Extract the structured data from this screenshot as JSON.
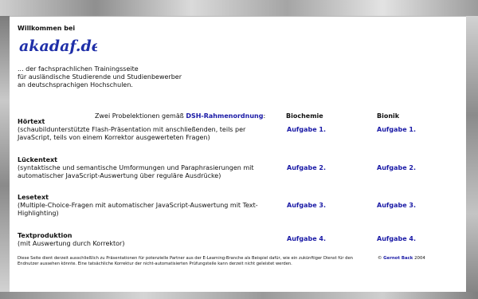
{
  "page": {
    "welcome": "Willkommen bei",
    "logo_text": "akadaf.de",
    "intro": [
      "... der fachsprachlichen Trainingsseite",
      "für ausländische Studierende und Studienbewerber",
      "an deutschsprachigen Hochschulen."
    ],
    "probe_prefix": "Zwei Probelektionen gemäß",
    "probe_link": "DSH-Rahmenordnung",
    "probe_suffix": ":",
    "columns": [
      "Biochemie",
      "Bionik"
    ],
    "sections": [
      {
        "title": "Hörtext",
        "desc": "(schaubildunterstützte Flash-Präsentation mit anschließenden, teils per JavaScript, teils von einem Korrektor ausgewerteten Fragen)",
        "task1": "Aufgabe 1.",
        "task2": "Aufgabe 1."
      },
      {
        "title": "Lückentext",
        "desc": "(syntaktische und semantische Umformungen und Paraphrasierungen mit automatischer JavaScript-Auswertung über reguläre Ausdrücke)",
        "task1": "Aufgabe 2.",
        "task2": "Aufgabe 2."
      },
      {
        "title": "Lesetext",
        "desc": "(Multiple-Choice-Fragen mit automatischer JavaScript-Auswertung mit Text-Highlighting)",
        "task1": "Aufgabe 3.",
        "task2": "Aufgabe 3."
      },
      {
        "title": "Textproduktion",
        "desc": "(mit Auswertung durch Korrektor)",
        "task1": "Aufgabe 4.",
        "task2": "Aufgabe 4."
      }
    ],
    "footer": "Diese Seite dient derzeit ausschließlich zu Präsentationen für potenzielle Partner aus der E-Learning-Branche als Beispiel dafür, wie ein zukünftiger Dienst für den Endnutzer aussehen könnte. Eine tatsächliche Korrektur der nicht-automatisierten Prüfungsteile kann derzeit nicht geleistet werden.",
    "copyright_symbol": "©",
    "copyright_name": "Gernot Back",
    "copyright_year": "2004"
  },
  "colors": {
    "link": "#1a1aa6",
    "logo": "#1f2fa8",
    "panel": "#ffffff"
  }
}
